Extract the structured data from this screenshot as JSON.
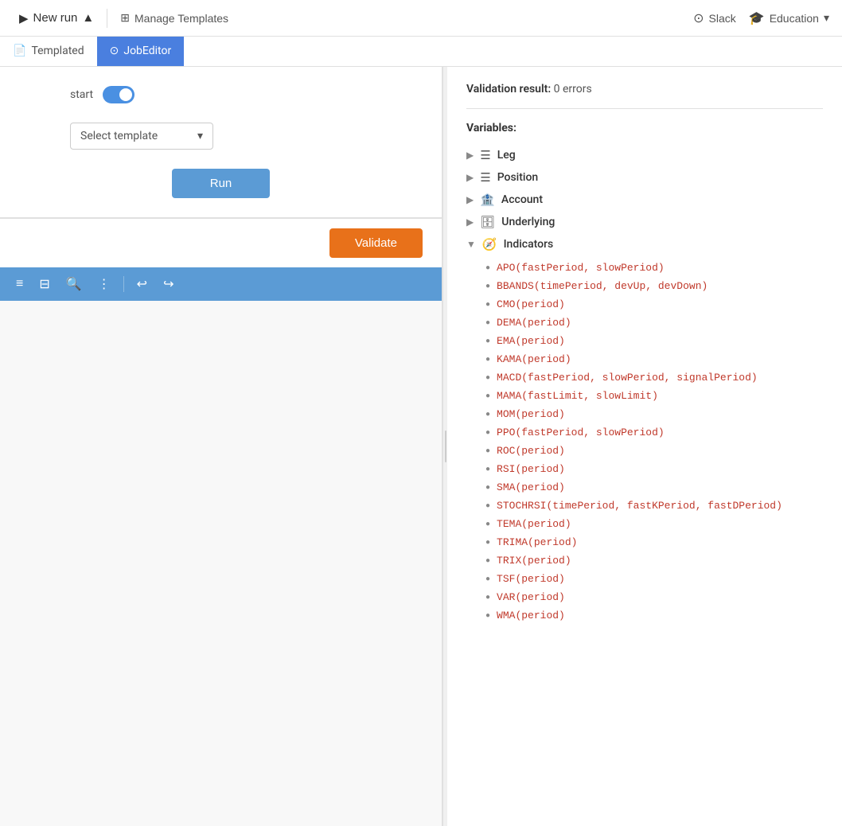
{
  "topnav": {
    "new_run_label": "New run",
    "manage_templates_label": "Manage Templates",
    "slack_label": "Slack",
    "education_label": "Education"
  },
  "subnav": {
    "templated_label": "Templated",
    "job_editor_label": "JobEditor"
  },
  "editor_section": {
    "start_label": "start",
    "select_template_placeholder": "Select template",
    "run_button_label": "Run"
  },
  "toolbar": {
    "sort_icon": "≡",
    "filter_icon": "⊟",
    "search_icon": "⌕",
    "more_icon": "⋮",
    "undo_icon": "↩",
    "redo_icon": "↪"
  },
  "validate_btn_label": "Validate",
  "right_panel": {
    "validation_result_label": "Validation result:",
    "errors_label": "0 errors",
    "variables_label": "Variables:",
    "tree_items": [
      {
        "name": "Leg",
        "icon": "list",
        "expanded": false
      },
      {
        "name": "Position",
        "icon": "list",
        "expanded": false
      },
      {
        "name": "Account",
        "icon": "bank",
        "expanded": false
      },
      {
        "name": "Underlying",
        "icon": "db",
        "expanded": false
      },
      {
        "name": "Indicators",
        "icon": "compass",
        "expanded": true
      }
    ],
    "indicators": [
      "APO(fastPeriod, slowPeriod)",
      "BBANDS(timePeriod, devUp, devDown)",
      "CMO(period)",
      "DEMA(period)",
      "EMA(period)",
      "KAMA(period)",
      "MACD(fastPeriod, slowPeriod, signalPeriod)",
      "MAMA(fastLimit, slowLimit)",
      "MOM(period)",
      "PPO(fastPeriod, slowPeriod)",
      "ROC(period)",
      "RSI(period)",
      "SMA(period)",
      "STOCHRSI(timePeriod, fastKPeriod, fastDPeriod)",
      "TEMA(period)",
      "TRIMA(period)",
      "TRIX(period)",
      "TSF(period)",
      "VAR(period)",
      "WMA(period)"
    ]
  }
}
